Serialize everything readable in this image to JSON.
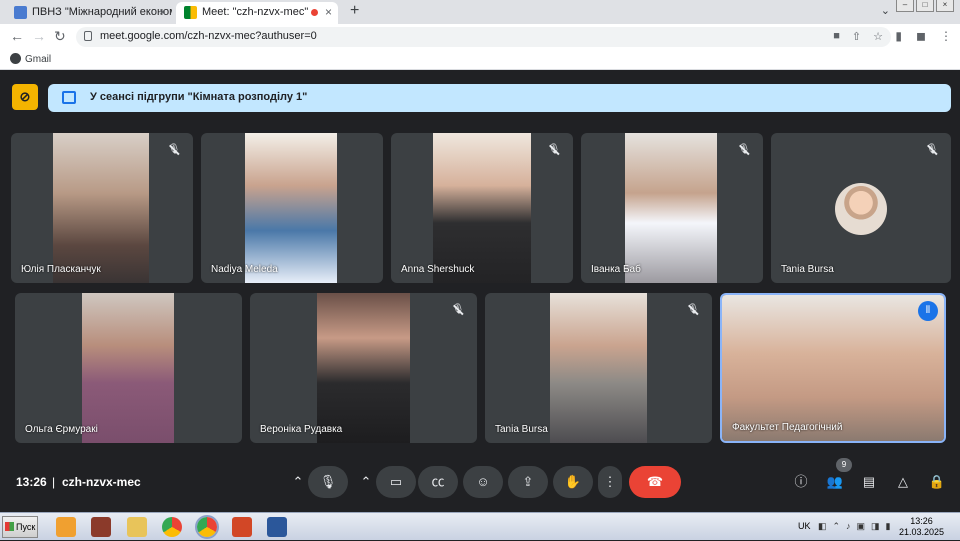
{
  "browser": {
    "tabs": [
      {
        "title": "ПВНЗ \"Міжнародний економіч",
        "close": "×"
      },
      {
        "title": "Meet: \"czh-nzvx-mec\"",
        "close": "×"
      }
    ],
    "new_tab": "+",
    "url": "meet.google.com/czh-nzvx-mec?authuser=0",
    "bookmarks": [
      {
        "label": "Gmail"
      }
    ]
  },
  "meet": {
    "banner_text": "У сеансі підгрупи \"Кімната розподілу 1\"",
    "participants": [
      {
        "name": "Юлія Пласканчук",
        "muted": true
      },
      {
        "name": "Nadiya Meleda",
        "muted": false
      },
      {
        "name": "Anna Shershuck",
        "muted": true
      },
      {
        "name": "Іванка Баб",
        "muted": true
      },
      {
        "name": "Tania Bursa",
        "muted": true
      },
      {
        "name": "Ольга Єрмуракі",
        "muted": false
      },
      {
        "name": "Вероніка Рудавка",
        "muted": true
      },
      {
        "name": "Tania Bursa",
        "muted": true
      },
      {
        "name": "Факультет Педагогічний",
        "muted": false,
        "speaking": true
      }
    ],
    "bottom": {
      "time": "13:26",
      "separator": "|",
      "meeting_code": "czh-nzvx-mec",
      "people_count": "9"
    }
  },
  "taskbar": {
    "start_label": "Пуск",
    "language": "UK",
    "clock_time": "13:26",
    "clock_date": "21.03.2025"
  },
  "colors": {
    "meet_bg": "#202124",
    "tile_bg": "#3c4043",
    "banner_bg": "#c2e7ff",
    "hangup": "#ea4335",
    "active_border": "#8ab4f8"
  }
}
